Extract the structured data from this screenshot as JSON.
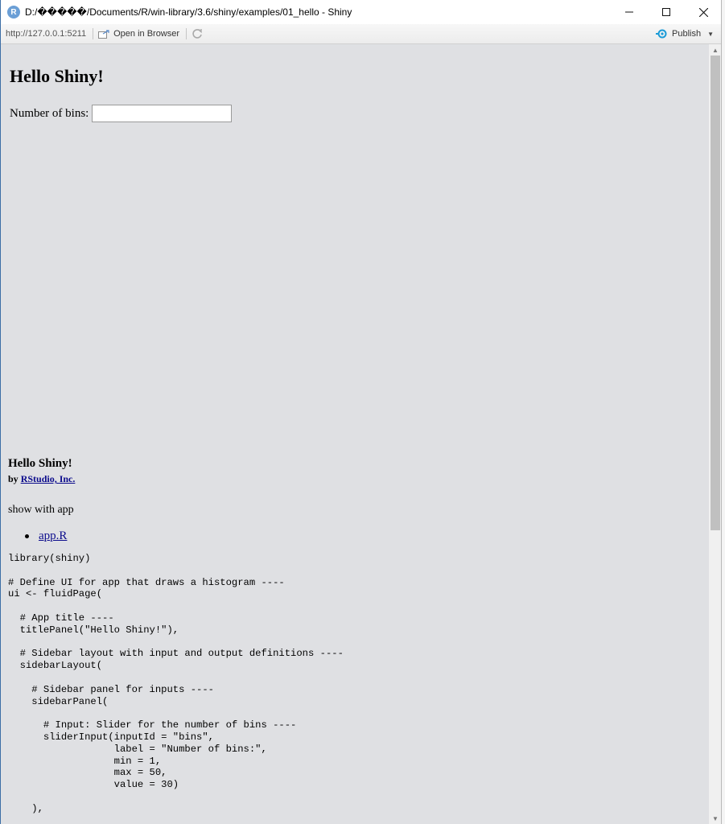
{
  "window": {
    "icon_letter": "R",
    "title": "D:/�����/Documents/R/win-library/3.6/shiny/examples/01_hello - Shiny"
  },
  "toolbar": {
    "url": "http://127.0.0.1:5211",
    "open_in_browser": "Open in Browser",
    "publish": "Publish"
  },
  "app": {
    "title": "Hello Shiny!",
    "bins_label": "Number of bins:",
    "bins_value": ""
  },
  "footer": {
    "title": "Hello Shiny!",
    "by": "by",
    "author": "RStudio, Inc.",
    "show_with_app": "show with app",
    "files": [
      "app.R"
    ]
  },
  "code": "library(shiny)\n\n# Define UI for app that draws a histogram ----\nui <- fluidPage(\n\n  # App title ----\n  titlePanel(\"Hello Shiny!\"),\n\n  # Sidebar layout with input and output definitions ----\n  sidebarLayout(\n\n    # Sidebar panel for inputs ----\n    sidebarPanel(\n\n      # Input: Slider for the number of bins ----\n      sliderInput(inputId = \"bins\",\n                  label = \"Number of bins:\",\n                  min = 1,\n                  max = 50,\n                  value = 30)\n\n    ),",
  "colors": {
    "content_bg": "#dfe0e3",
    "link": "#0b0b8c",
    "publish_icon": "#1a9bd7"
  }
}
